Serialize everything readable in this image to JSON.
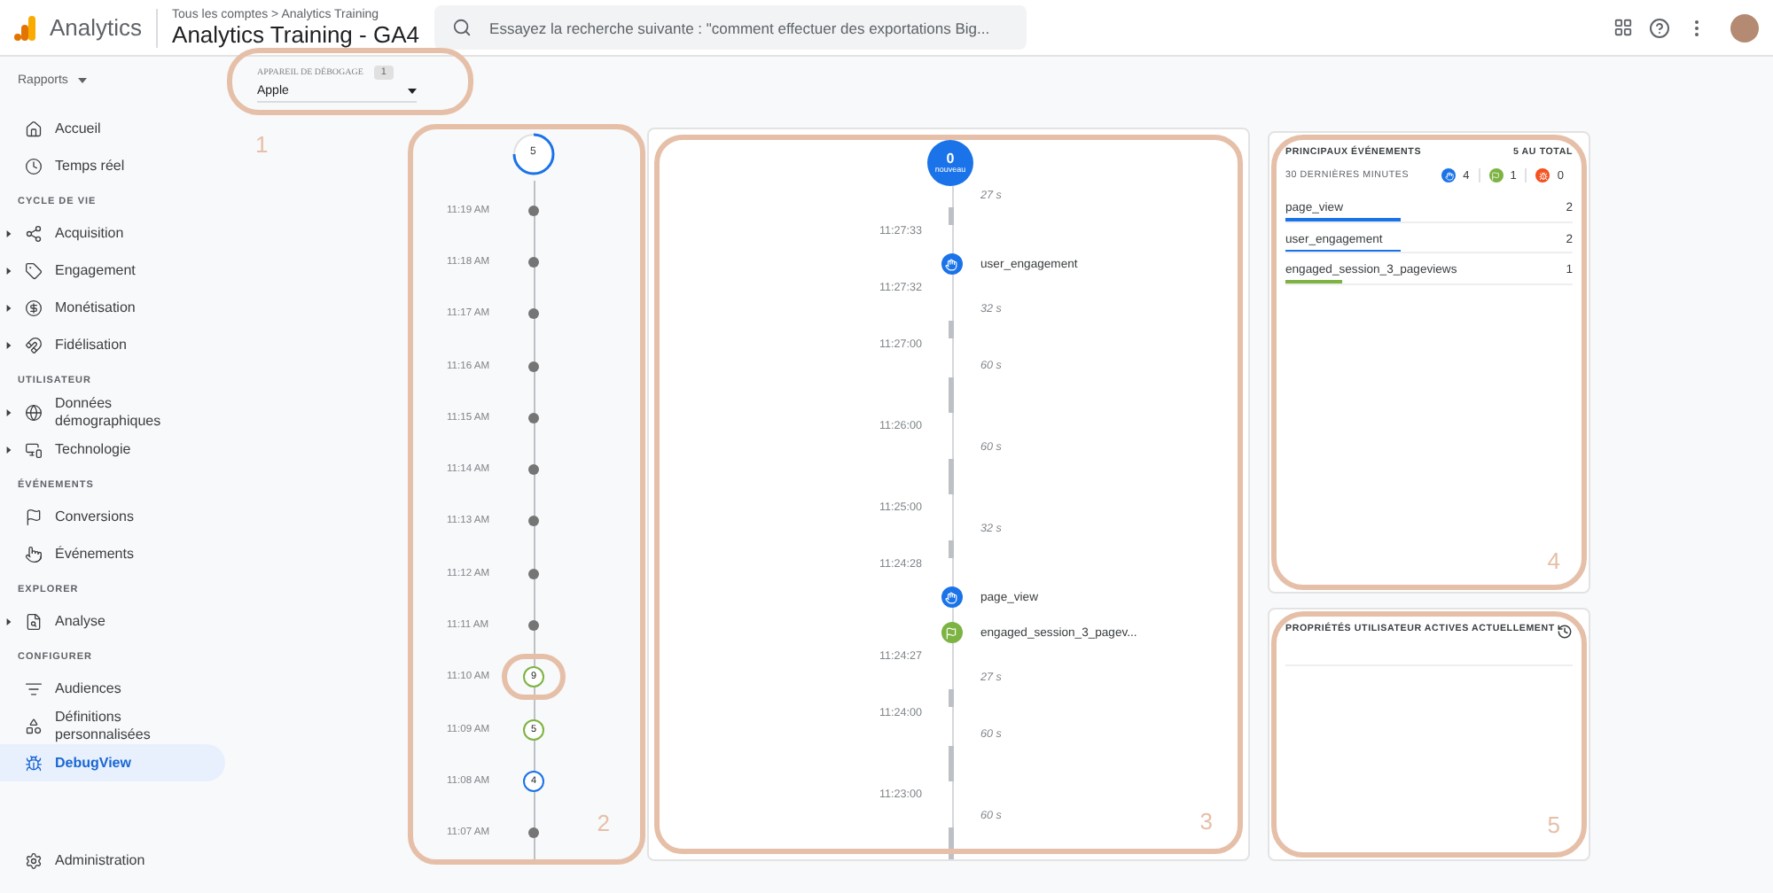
{
  "header": {
    "product": "Analytics",
    "breadcrumb": "Tous les comptes > Analytics Training",
    "property": "Analytics Training - GA4",
    "search": {
      "placeholder": "Essayez la recherche suivante : \"comment effectuer des exportations Big..."
    }
  },
  "sidebar": {
    "menu_label": "Rapports",
    "sections": [
      {
        "items": [
          {
            "label": "Accueil",
            "expandable": false,
            "selected": false
          },
          {
            "label": "Temps réel",
            "expandable": false,
            "selected": false
          }
        ]
      },
      {
        "heading": "CYCLE DE VIE",
        "items": [
          {
            "label": "Acquisition",
            "expandable": true,
            "selected": false
          },
          {
            "label": "Engagement",
            "expandable": true,
            "selected": false
          },
          {
            "label": "Monétisation",
            "expandable": true,
            "selected": false
          },
          {
            "label": "Fidélisation",
            "expandable": true,
            "selected": false
          }
        ]
      },
      {
        "heading": "UTILISATEUR",
        "items": [
          {
            "label": "Données démographiques",
            "expandable": true,
            "selected": false
          },
          {
            "label": "Technologie",
            "expandable": true,
            "selected": false
          }
        ]
      },
      {
        "heading": "ÉVÉNEMENTS",
        "items": [
          {
            "label": "Conversions",
            "expandable": false,
            "selected": false
          },
          {
            "label": "Événements",
            "expandable": false,
            "selected": false
          }
        ]
      },
      {
        "heading": "EXPLORER",
        "items": [
          {
            "label": "Analyse",
            "expandable": true,
            "selected": false
          }
        ]
      },
      {
        "heading": "CONFIGURER",
        "items": [
          {
            "label": "Audiences",
            "expandable": false,
            "selected": false
          },
          {
            "label": "Définitions personnalisées",
            "expandable": false,
            "selected": false
          },
          {
            "label": "DebugView",
            "expandable": false,
            "selected": true
          }
        ]
      }
    ],
    "footer_item": {
      "label": "Administration",
      "selected": false
    }
  },
  "device_selector": {
    "label": "APPAREIL DE DÉBOGAGE",
    "badge": "1",
    "value": "Apple"
  },
  "minute_timeline": {
    "current_count": "5",
    "rows": [
      {
        "time": "11:19 AM",
        "kind": "dot",
        "highlighted": false
      },
      {
        "time": "11:18 AM",
        "kind": "dot",
        "highlighted": false
      },
      {
        "time": "11:17 AM",
        "kind": "dot",
        "highlighted": false
      },
      {
        "time": "11:16 AM",
        "kind": "dot",
        "highlighted": false
      },
      {
        "time": "11:15 AM",
        "kind": "dot",
        "highlighted": false
      },
      {
        "time": "11:14 AM",
        "kind": "dot",
        "highlighted": false
      },
      {
        "time": "11:13 AM",
        "kind": "dot",
        "highlighted": false
      },
      {
        "time": "11:12 AM",
        "kind": "dot",
        "highlighted": false
      },
      {
        "time": "11:11 AM",
        "kind": "dot",
        "highlighted": false
      },
      {
        "time": "11:10 AM",
        "kind": "count",
        "count": "9",
        "color": "#7cb342",
        "highlighted": true
      },
      {
        "time": "11:09 AM",
        "kind": "count",
        "count": "5",
        "color": "#7cb342",
        "highlighted": false
      },
      {
        "time": "11:08 AM",
        "kind": "count",
        "count": "4",
        "color": "#1a73e8",
        "highlighted": false
      },
      {
        "time": "11:07 AM",
        "kind": "dot",
        "highlighted": false
      }
    ]
  },
  "seconds_stream": {
    "new_count": "0",
    "new_label": "nouveau",
    "items": [
      {
        "kind": "short_gap",
        "label": "27 s"
      },
      {
        "kind": "time",
        "label": "11:27:33"
      },
      {
        "kind": "event",
        "label": "user_engagement"
      },
      {
        "kind": "time",
        "label": "11:27:32"
      },
      {
        "kind": "short_gap",
        "label": "32 s"
      },
      {
        "kind": "time",
        "label": "11:27:00"
      },
      {
        "kind": "long_gap",
        "label": "60 s"
      },
      {
        "kind": "time",
        "label": "11:26:00"
      },
      {
        "kind": "long_gap",
        "label": "60 s"
      },
      {
        "kind": "time",
        "label": "11:25:00"
      },
      {
        "kind": "short_gap",
        "label": "32 s"
      },
      {
        "kind": "time",
        "label": "11:24:28"
      },
      {
        "kind": "event",
        "label": "page_view"
      },
      {
        "kind": "conversion",
        "label": "engaged_session_3_pagev..."
      },
      {
        "kind": "time",
        "label": "11:24:27"
      },
      {
        "kind": "short_gap",
        "label": "27 s"
      },
      {
        "kind": "time",
        "label": "11:24:00"
      },
      {
        "kind": "long_gap",
        "label": "60 s"
      },
      {
        "kind": "time",
        "label": "11:23:00"
      },
      {
        "kind": "long_gap",
        "label": "60 s"
      }
    ]
  },
  "top_events": {
    "title": "PRINCIPAUX ÉVÉNEMENTS",
    "total": "5 AU TOTAL",
    "period": "30 DERNIÈRES MINUTES",
    "legend": [
      {
        "kind": "event",
        "count": "4",
        "color": "#1a73e8"
      },
      {
        "kind": "conversion",
        "count": "1",
        "color": "#7cb342"
      },
      {
        "kind": "error",
        "count": "0",
        "color": "#f4511e"
      }
    ],
    "rows": [
      {
        "name": "page_view",
        "count": "2",
        "level": 0.4,
        "color": "#1a73e8"
      },
      {
        "name": "user_engagement",
        "count": "2",
        "level": 0.4,
        "color": "#1a73e8"
      },
      {
        "name": "engaged_session_3_pageviews",
        "count": "1",
        "level": 0.2,
        "color": "#7cb342"
      }
    ]
  },
  "user_properties": {
    "title": "PROPRIÉTÉS UTILISATEUR ACTIVES ACTUELLEMENT"
  },
  "annotations": [
    "1",
    "2",
    "3",
    "4",
    "5"
  ]
}
